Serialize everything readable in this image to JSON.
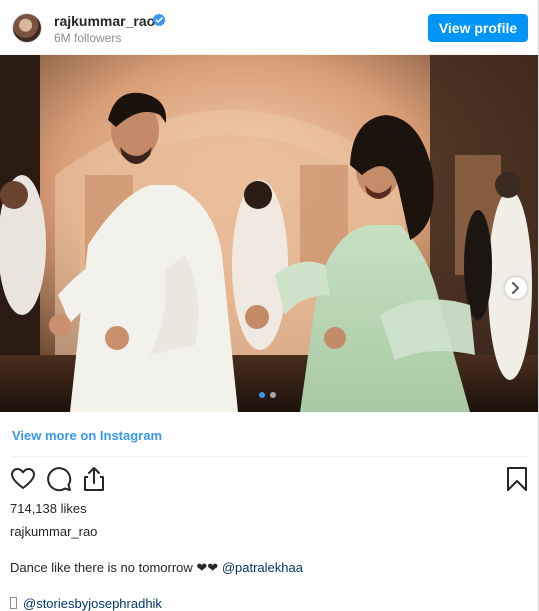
{
  "header": {
    "username": "rajkummar_rao",
    "followers": "6M followers",
    "view_profile_label": "View profile",
    "verified_icon": "verified-badge-icon"
  },
  "post": {
    "carousel": {
      "total_slides": 2,
      "current_slide": 1
    },
    "view_more_label": "View more on Instagram",
    "likes": "714,138 likes",
    "caption_username": "rajkummar_rao",
    "caption_text": "Dance like there is no tomorrow ❤❤",
    "caption_mention": "@patralekhaa",
    "credit_mention": "@storiesbyjosephradhik"
  },
  "icons": [
    "heart-icon",
    "comment-icon",
    "share-icon",
    "bookmark-icon",
    "chevron-right-icon"
  ],
  "colors": {
    "accent": "#0095f6",
    "link": "#3897f0",
    "mention": "#00376b",
    "text": "#262626",
    "muted": "#8e8e8e"
  }
}
